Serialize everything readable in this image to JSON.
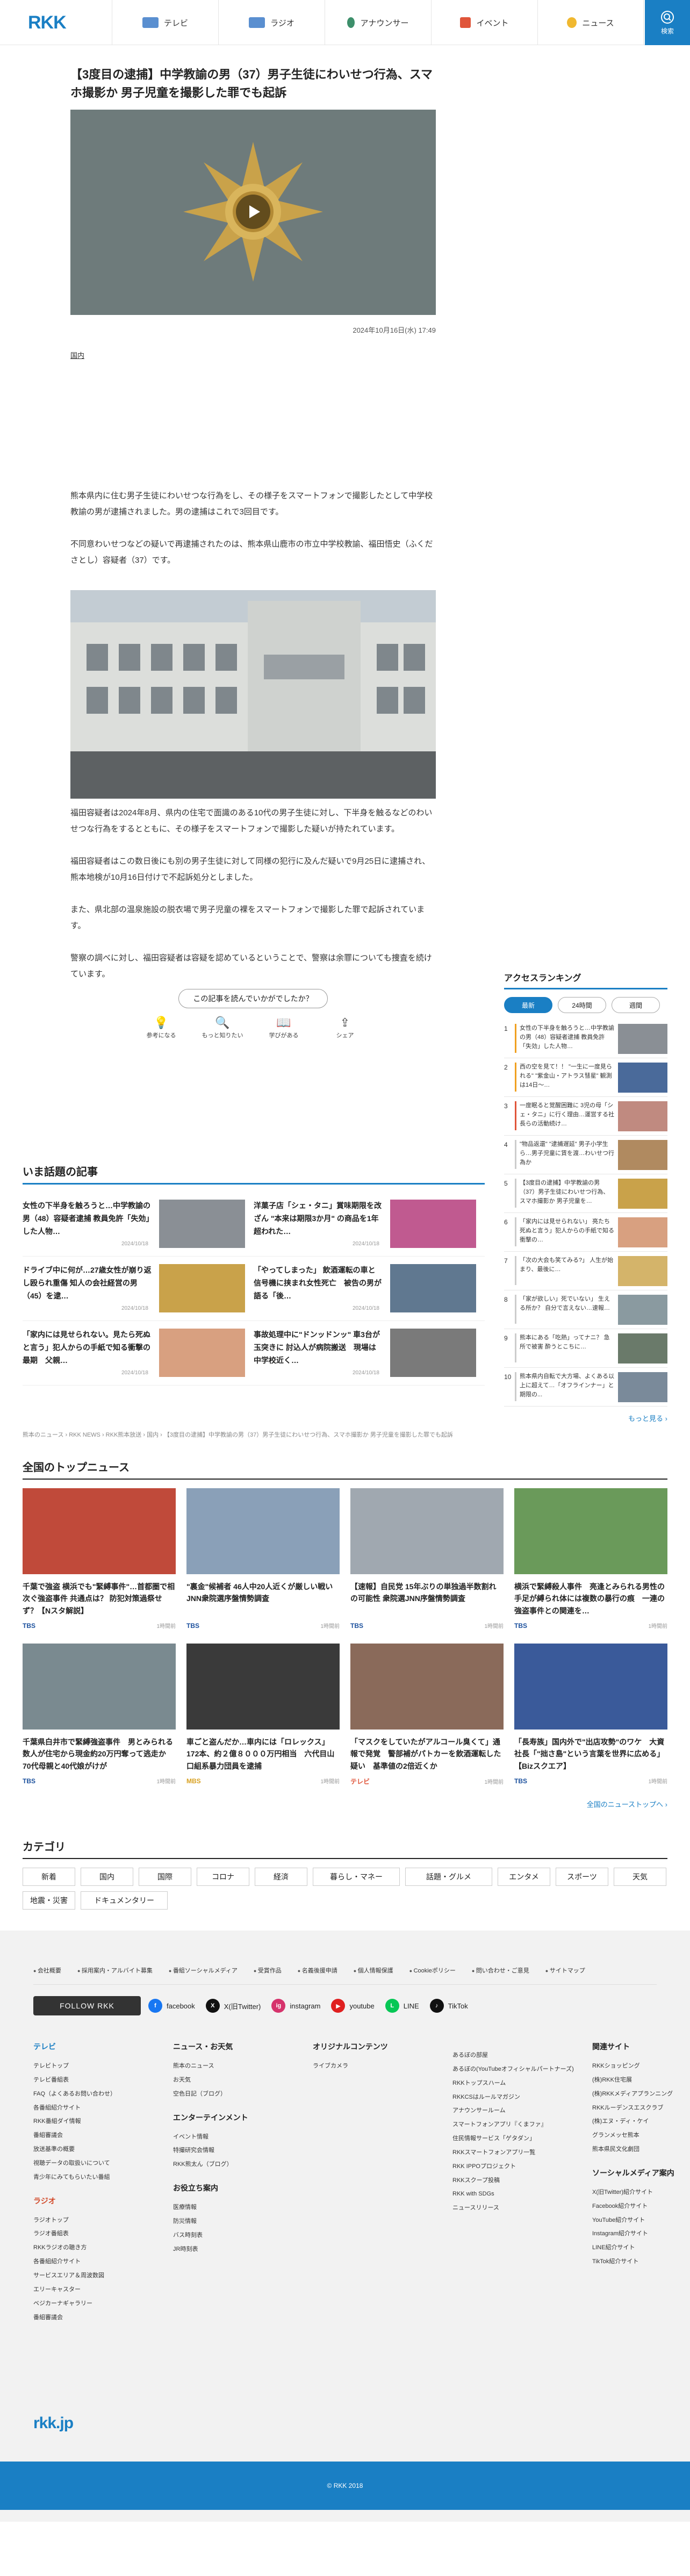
{
  "header": {
    "logo": "RKK",
    "nav": [
      {
        "label": "テレビ",
        "color": "#5a8fd0"
      },
      {
        "label": "ラジオ",
        "color": "#5a8fd0"
      },
      {
        "label": "アナウンサー",
        "color": "#3d8f6b"
      },
      {
        "label": "イベント",
        "color": "#e0553a"
      },
      {
        "label": "ニュース",
        "color": "#f0b830"
      }
    ],
    "search_label": "検索"
  },
  "article": {
    "title": "【3度目の逮捕】中学教諭の男（37）男子生徒にわいせつ行為、スマホ撮影か 男子児童を撮影した罪でも起訴",
    "date": "2024年10月16日(水) 17:49",
    "tag": "国内",
    "paragraphs": [
      "熊本県内に住む男子生徒にわいせつな行為をし、その様子をスマートフォンで撮影したとして中学校教諭の男が逮捕されました。男の逮捕はこれで3回目です。",
      "不同意わいせつなどの疑いで再逮捕されたのは、熊本県山鹿市の市立中学校教諭、福田悟史（ふくだ さとし）容疑者（37）です。",
      "福田容疑者は2024年8月、県内の住宅で面識のある10代の男子生徒に対し、下半身を触るなどのわいせつな行為をするとともに、その様子をスマートフォンで撮影した疑いが持たれています。",
      "福田容疑者はこの数日後にも別の男子生徒に対して同様の犯行に及んだ疑いで9月25日に逮捕され、熊本地検が10月16日付けで不起訴処分としました。",
      "また、県北部の温泉施設の脱衣場で男子児童の裸をスマートフォンで撮影した罪で起訴されています。",
      "警察の調べに対し、福田容疑者は容疑を認めているということで、警察は余罪についても捜査を続けています。"
    ]
  },
  "feedback": {
    "question": "この記事を読んでいかがでしたか？",
    "options": [
      {
        "label": "参考になる",
        "icon": "💡"
      },
      {
        "label": "もっと知りたい",
        "icon": "🔍"
      },
      {
        "label": "学びがある",
        "icon": "📖"
      },
      {
        "label": "シェア",
        "icon": "⇪"
      }
    ]
  },
  "ranking": {
    "title": "アクセスランキング",
    "tabs": [
      "最新",
      "24時間",
      "週間"
    ],
    "items": [
      {
        "num": "1",
        "text": "女性の下半身を触ろうと…中学教諭の男（48）容疑者逮捕 教員免許「失効」した人物…",
        "bar": "#f0a020",
        "thumb": "#8a8f95"
      },
      {
        "num": "2",
        "text": "西の空を見て！！ \"一生に一度見られる\" \"紫金山・アトラス彗星\" 観測は14日～…",
        "bar": "#f0a020",
        "thumb": "#4a6a9a"
      },
      {
        "num": "3",
        "text": "一度眠ると覚醒困難に 3児の母「シェ・タニ」に行く理由…運営する社長らの活動続け…",
        "bar": "#e0553a",
        "thumb": "#c08a80"
      },
      {
        "num": "4",
        "text": "\"物品返還\" \"逮捕遅延\" 男子小学生ら…男子児童に賃を渡…わいせつ行為か",
        "bar": "#ccc",
        "thumb": "#b08a60"
      },
      {
        "num": "5",
        "text": "【3度目の逮捕】中学教諭の男（37）男子生徒にわいせつ行為、スマホ撮影か 男子児童を…",
        "bar": "#ccc",
        "thumb": "#c9a24a"
      },
      {
        "num": "6",
        "text": "「家内には見せられない」 亮たち死ぬと言う」犯人からの手紙で知る衝撃の…",
        "bar": "#ccc",
        "thumb": "#d8a080"
      },
      {
        "num": "7",
        "text": "「次の大会も笑てみる?」 人生が始まり、最後に…",
        "bar": "#ccc",
        "thumb": "#d4b46a"
      },
      {
        "num": "8",
        "text": "「家が欲しい」死でいない」 生える所か？ 自分で言えない…速報…",
        "bar": "#ccc",
        "thumb": "#8a9aa0"
      },
      {
        "num": "9",
        "text": "熊本にある「吃熱」ってナニ？ 急所で被害 酔うとこちに…",
        "bar": "#ccc",
        "thumb": "#6a7a6a"
      },
      {
        "num": "10",
        "text": "熊本県内自転で大方場、よくある以上に超えて…「オフラインナー」と期限の...",
        "bar": "#ccc",
        "thumb": "#7a8a9a"
      }
    ],
    "more": "もっと見る ›"
  },
  "trending": {
    "title": "いま話題の記事",
    "items": [
      {
        "text": "女性の下半身を触ろうと…中学教諭の男（48）容疑者逮捕 教員免許「失効」した人物…",
        "date": "2024/10/18",
        "thumb": "#8a8f95"
      },
      {
        "text": "洋菓子店「シェ・タニ」賞味期限を改ざん \"本来は期限3か月\" の商品を1年超われた…",
        "date": "2024/10/18",
        "thumb": "#c05a90"
      },
      {
        "text": "ドライブ中に何が…27歳女性が崩り返し殴られ重傷 知人の会社経営の男（45）を逮…",
        "date": "2024/10/18",
        "thumb": "#c9a24a"
      },
      {
        "text": "「やってしまった」 飲酒運転の車と信号機に挟まれ女性死亡　被告の男が語る「後…",
        "date": "2024/10/18",
        "thumb": "#607890"
      },
      {
        "text": "「家内には見せられない。見たら死ぬと言う」犯人からの手紙で知る衝撃の最期　父親…",
        "date": "2024/10/18",
        "thumb": "#d8a080"
      },
      {
        "text": "事故処理中に\"ドンッドンッ\" 車3台が玉突きに 討込人が病院搬送　現場は中学校近く…",
        "date": "2024/10/18",
        "thumb": "#7a7a7a"
      }
    ]
  },
  "breadcrumb": "熊本のニュース › RKK NEWS › RKK熊本放送 › 国内 › 【3度目の逮捕】中学教諭の男（37）男子生徒にわいせつ行為、スマホ撮影か 男子児童を撮影した罪でも起訴",
  "topnews": {
    "title": "全国のトップニュース",
    "items": [
      {
        "text": "千葉で強盗 横浜でも\"緊縛事件\"…首都圏で相次ぐ強盗事件 共通点は？ 防犯対策過祭せず？【Nスタ解説】",
        "source": "TBS",
        "source_color": "#1a4f9c",
        "date": "1時間前",
        "thumb": "#c04a3a"
      },
      {
        "text": "\"裏金\"候補者 46人中20人近くが厳しい戦い JNN衆院選序盤情勢調査",
        "source": "TBS",
        "source_color": "#1a4f9c",
        "date": "1時間前",
        "thumb": "#8aa0b8"
      },
      {
        "text": "【速報】自民党 15年ぶりの単独過半数割れの可能性 衆院選JNN序盤情勢調査",
        "source": "TBS",
        "source_color": "#1a4f9c",
        "date": "1時間前",
        "thumb": "#a0a8b0"
      },
      {
        "text": "横浜で緊縛殺人事件　亮逢とみられる男性の手足が縛られ体には複数の暴行の痕　一連の強盗事件との関連を…",
        "source": "TBS",
        "source_color": "#1a4f9c",
        "date": "1時間前",
        "thumb": "#6a9a5a"
      },
      {
        "text": "千葉県白井市で緊縛強盗事件　男とみられる数人が住宅から現金約20万円奪って逃走か　70代母親と40代娘がけが",
        "source": "TBS",
        "source_color": "#1a4f9c",
        "date": "1時間前",
        "thumb": "#7a8a90"
      },
      {
        "text": "車ごと盗んだか…車内には「ロレックス」172本、約２億８０００万円相当　六代目山口組系暴力団員を逮捕",
        "source": "MBS",
        "source_color": "#d8a020",
        "date": "1時間前",
        "thumb": "#3a3a3a"
      },
      {
        "text": "「マスクをしていたがアルコール臭くて」通報で発覚　警部補がパトカーを飲酒運転した疑い　基準値の2倍近くか",
        "source": "テレビ",
        "source_color": "#e0553a",
        "date": "1時間前",
        "thumb": "#8a6a5a"
      },
      {
        "text": "「長寿族」国内外で\"出店攻勢\"のワケ　大資社長「\"拙さ島\"という言葉を世界に広める」【Bizスクエア】",
        "source": "TBS",
        "source_color": "#1a4f9c",
        "date": "1時間前",
        "thumb": "#3a5a9a"
      }
    ],
    "more": "全国のニューストップへ ›"
  },
  "category": {
    "title": "カテゴリ",
    "items": [
      "新着",
      "国内",
      "国際",
      "コロナ",
      "経済",
      "暮らし・マネー",
      "話題・グルメ",
      "エンタメ",
      "スポーツ",
      "天気",
      "地震・災害",
      "ドキュメンタリー"
    ]
  },
  "footer": {
    "links": [
      "会社概要",
      "採用案内・アルバイト募集",
      "番組ソーシャルメディア",
      "受賞作品",
      "名義後援申請",
      "個人情報保護",
      "Cookieポリシー",
      "問い合わせ・ご意見",
      "サイトマップ"
    ],
    "follow": "FOLLOW RKK",
    "sns": [
      {
        "label": "facebook",
        "short": "f",
        "color": "#1877f2"
      },
      {
        "label": "X(旧Twitter)",
        "short": "X",
        "color": "#111"
      },
      {
        "label": "instagram",
        "short": "ig",
        "color": "#d6336c"
      },
      {
        "label": "youtube",
        "short": "▶",
        "color": "#e02020"
      },
      {
        "label": "LINE",
        "short": "L",
        "color": "#06c755"
      },
      {
        "label": "TikTok",
        "short": "♪",
        "color": "#111"
      }
    ],
    "cols": [
      {
        "sections": [
          {
            "head": "テレビ",
            "style": "blue",
            "items": [
              "テレビトップ",
              "テレビ番組表",
              "FAQ（よくあるお問い合わせ）",
              "各番組紹介サイト",
              "RKK番組ダイ情報",
              "番組審議会",
              "放送基準の概要",
              "視聴データの取扱いについて",
              "青少年にみてもらいたい番組"
            ]
          },
          {
            "head": "ラジオ",
            "style": "red",
            "items": [
              "ラジオトップ",
              "ラジオ番組表",
              "RKKラジオの聴き方",
              "各番組紹介サイト",
              "サービスエリア＆周波数図",
              "エリーキャスター",
              "ベジカーナギャラリー",
              "番組審議会"
            ]
          }
        ]
      },
      {
        "sections": [
          {
            "head": "ニュース・お天気",
            "style": "",
            "items": [
              "熊本のニュース",
              "お天気",
              "空色日記（ブログ）"
            ]
          },
          {
            "head": "エンターテインメント",
            "style": "",
            "items": [
              "イベント情報",
              "特撮研究会情報",
              "RKK熊太ん（ブログ）"
            ]
          },
          {
            "head": "お役立ち案内",
            "style": "",
            "items": [
              "医療情報",
              "防災情報",
              "バス時刻表",
              "JR時刻表"
            ]
          }
        ]
      },
      {
        "sections": [
          {
            "head": "オリジナルコンテンツ",
            "style": "",
            "items": [
              "ライブカメラ"
            ]
          }
        ]
      },
      {
        "sections": [
          {
            "head": "",
            "style": "",
            "items": [
              "あるぼの部屋",
              "あるぼの(YouTubeオフィシャルパートナーズ)",
              "RKKトップスハーム",
              "RKKCSはルールマガジン",
              "アナウンサールーム",
              "スマートフォンアプリ『くまファ』",
              "住民情報サービス「ゲタダン」",
              "RKKスマートフォンアプリ一覧",
              "RKK IPPOプロジェクト",
              "RKKスクープ投稿",
              "RKK with SDGs",
              "ニュースリリース"
            ]
          }
        ]
      },
      {
        "sections": [
          {
            "head": "関連サイト",
            "style": "",
            "items": [
              "RKKショッピング",
              "(株)RKK住宅展",
              "(株)RKKメディアプランニング",
              "RKKルーデンスエスクラブ",
              "(株)エヌ・ディ・ケイ",
              "グランメッセ熊本",
              "熊本県民文化劇団"
            ]
          },
          {
            "head": "ソーシャルメディア案内",
            "style": "",
            "items": [
              "X(旧Twitter)紹介サイト",
              "Facebook紹介サイト",
              "YouTube紹介サイト",
              "Instagram紹介サイト",
              "LINE紹介サイト",
              "TikTok紹介サイト"
            ]
          }
        ]
      }
    ],
    "bottom_logo": "rkk.jp",
    "copyright": "© RKK 2018"
  }
}
